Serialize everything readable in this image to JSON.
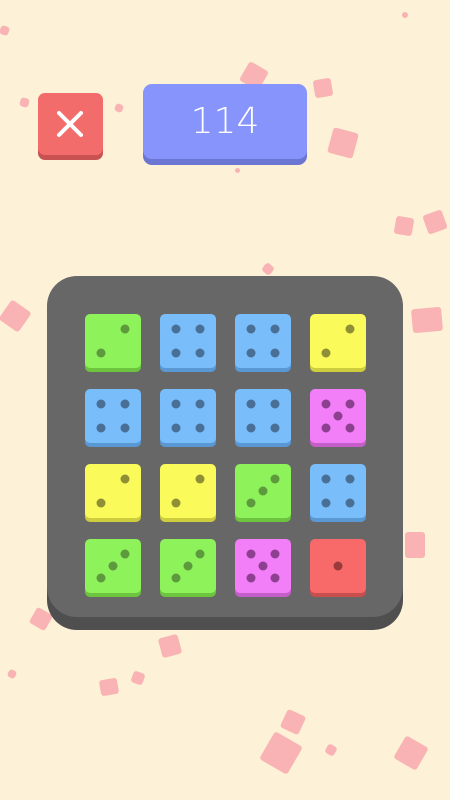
{
  "header": {
    "close_icon": "close-icon",
    "score": "114"
  },
  "colors": {
    "background": "#fdf2d7",
    "close_button": "#f26c6c",
    "score_box": "#8694fb",
    "board": "#676767",
    "confetti": "#f9a8ae"
  },
  "board": {
    "rows": [
      [
        {
          "value": 2,
          "color": "green"
        },
        {
          "value": 4,
          "color": "blue"
        },
        {
          "value": 4,
          "color": "blue"
        },
        {
          "value": 2,
          "color": "yellow"
        }
      ],
      [
        {
          "value": 4,
          "color": "blue"
        },
        {
          "value": 4,
          "color": "blue"
        },
        {
          "value": 4,
          "color": "blue"
        },
        {
          "value": 5,
          "color": "magenta"
        }
      ],
      [
        {
          "value": 2,
          "color": "yellow"
        },
        {
          "value": 2,
          "color": "yellow"
        },
        {
          "value": 3,
          "color": "green"
        },
        {
          "value": 4,
          "color": "blue"
        }
      ],
      [
        {
          "value": 3,
          "color": "green"
        },
        {
          "value": 3,
          "color": "green"
        },
        {
          "value": 5,
          "color": "magenta"
        },
        {
          "value": 1,
          "color": "red"
        }
      ]
    ]
  },
  "die_palette": {
    "green": {
      "face": "#8ef25a",
      "edge": "#6cc43f",
      "pip": "#5d9a3d"
    },
    "blue": {
      "face": "#79bdfa",
      "edge": "#5a98d4",
      "pip": "#4a6f96"
    },
    "yellow": {
      "face": "#fafb5b",
      "edge": "#cdcd3e",
      "pip": "#8f8f35"
    },
    "magenta": {
      "face": "#f27ff7",
      "edge": "#c45ec9",
      "pip": "#8d3f90"
    },
    "red": {
      "face": "#f86a6a",
      "edge": "#c94e4e",
      "pip": "#9a3a3a"
    }
  }
}
